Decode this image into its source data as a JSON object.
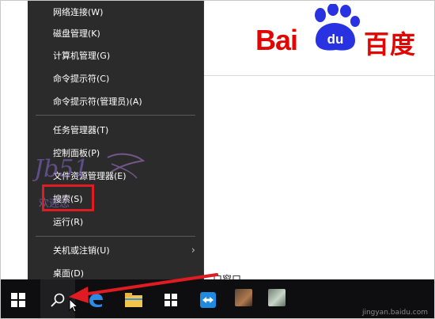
{
  "baidu": {
    "latin": "Bai",
    "paw_text": "du",
    "chinese": "百度",
    "color": "#e10601"
  },
  "background_text": "口窗口",
  "context_menu": {
    "items": [
      {
        "label": "网络连接(W)"
      },
      {
        "label": "磁盘管理(K)"
      },
      {
        "label": "计算机管理(G)"
      },
      {
        "label": "命令提示符(C)"
      },
      {
        "label": "命令提示符(管理员)(A)"
      },
      {
        "label": "任务管理器(T)"
      },
      {
        "label": "控制面板(P)"
      },
      {
        "label": "文件资源管理器(E)"
      },
      {
        "label": "搜索(S)"
      },
      {
        "label": "运行(R)"
      },
      {
        "label": "关机或注销(U)",
        "submenu_icon": "chevron-right-icon",
        "submenu_glyph": "›"
      },
      {
        "label": "桌面(D)"
      }
    ],
    "highlighted_item": "搜索(S)",
    "highlight_color": "#e11b22"
  },
  "watermark": {
    "text": "Jb51",
    "sub": "欢迎您"
  },
  "taskbar": {
    "start_icon": "windows-logo-icon",
    "search_icon": "search-icon",
    "pinned_icons": [
      "edge-browser-icon",
      "file-explorer-icon",
      "store-icon",
      "teamviewer-icon",
      "app-icon-blurred-1",
      "app-icon-blurred-2"
    ]
  },
  "annotation_arrow_color": "#e11b22",
  "site_watermark": "jingyan.baidu.com"
}
